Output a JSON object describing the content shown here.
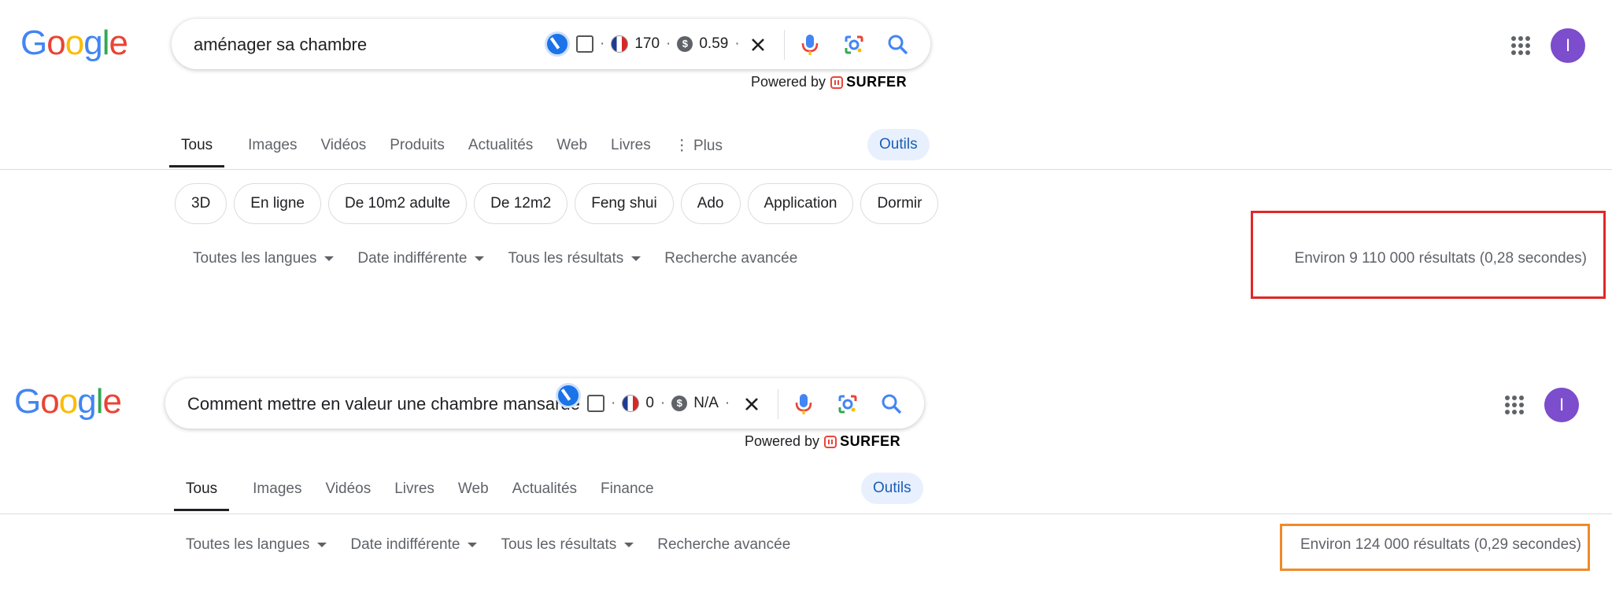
{
  "colors": {
    "google_blue": "#4285F4",
    "google_red": "#EA4335",
    "google_yellow": "#FBBC05",
    "google_green": "#34A853",
    "highlight_red": "#e02727",
    "highlight_orange": "#ef8a2a",
    "avatar_purple": "#7c4dcc"
  },
  "panel1": {
    "logo": [
      "G",
      "o",
      "o",
      "g",
      "l",
      "e"
    ],
    "query": "aménager sa chambre",
    "widget": {
      "dot": "·",
      "volume": "170",
      "cpc": "0.59",
      "coin_symbol": "$"
    },
    "powered_by": "Powered by",
    "surfer": "SURFER",
    "tabs": [
      "Tous",
      "Images",
      "Vidéos",
      "Produits",
      "Actualités",
      "Web",
      "Livres",
      "⋮ Plus"
    ],
    "tools": "Outils",
    "chips": [
      "3D",
      "En ligne",
      "De 10m2 adulte",
      "De 12m2",
      "Feng shui",
      "Ado",
      "Application",
      "Dormir"
    ],
    "filters": [
      "Toutes les langues",
      "Date indifférente",
      "Tous les résultats"
    ],
    "advanced": "Recherche avancée",
    "results": "Environ 9 110 000 résultats (0,28 secondes)",
    "avatar": "I"
  },
  "panel2": {
    "logo": [
      "G",
      "o",
      "o",
      "g",
      "l",
      "e"
    ],
    "query": "Comment mettre en valeur une chambre mansardé",
    "widget": {
      "dot": "·",
      "volume": "0",
      "cpc": "N/A",
      "coin_symbol": "$"
    },
    "powered_by": "Powered by",
    "surfer": "SURFER",
    "tabs": [
      "Tous",
      "Images",
      "Vidéos",
      "Livres",
      "Web",
      "Actualités",
      "Finance"
    ],
    "tools": "Outils",
    "filters": [
      "Toutes les langues",
      "Date indifférente",
      "Tous les résultats"
    ],
    "advanced": "Recherche avancée",
    "results": "Environ 124 000 résultats (0,29 secondes)",
    "avatar": "I"
  }
}
